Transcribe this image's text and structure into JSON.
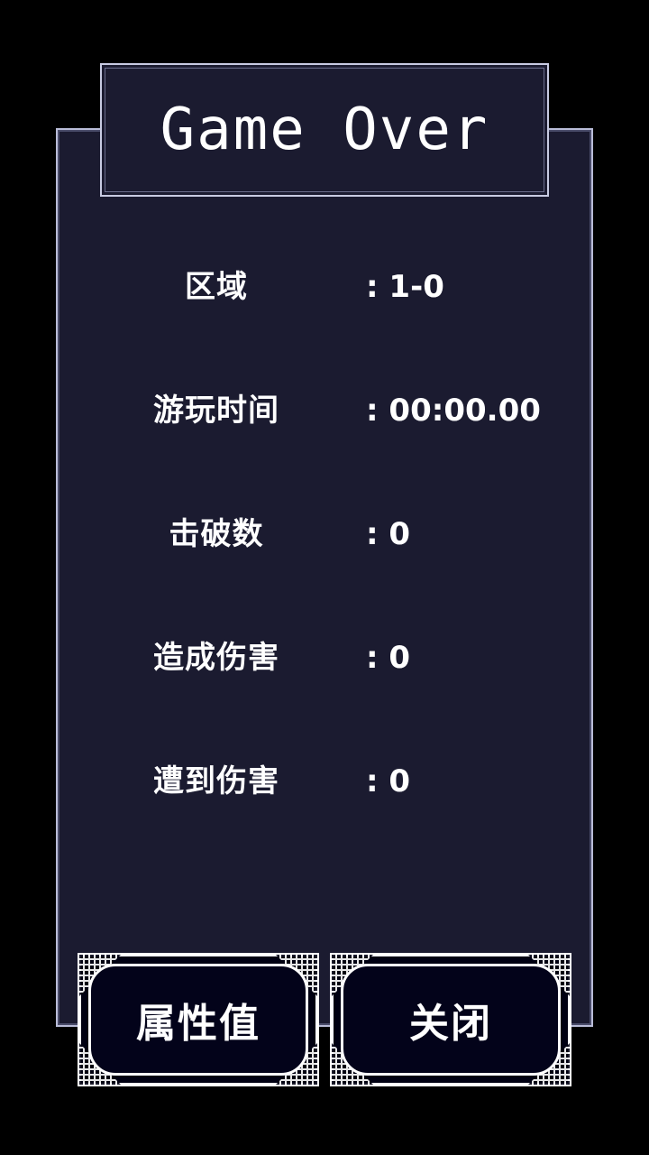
{
  "title": "Game Over",
  "stats": [
    {
      "label": "区域",
      "value": ": 1-0"
    },
    {
      "label": "游玩时间",
      "value": ": 00:00.00"
    },
    {
      "label": "击破数",
      "value": ": 0"
    },
    {
      "label": "造成伤害",
      "value": ": 0"
    },
    {
      "label": "遭到伤害",
      "value": ": 0"
    }
  ],
  "buttons": {
    "attributes_label": "属性值",
    "close_label": "关闭"
  },
  "colors": {
    "background": "#000000",
    "panel": "#1b1b30",
    "panel_border": "#b9bcd8",
    "button_bg": "#03031a",
    "text": "#ffffff"
  }
}
